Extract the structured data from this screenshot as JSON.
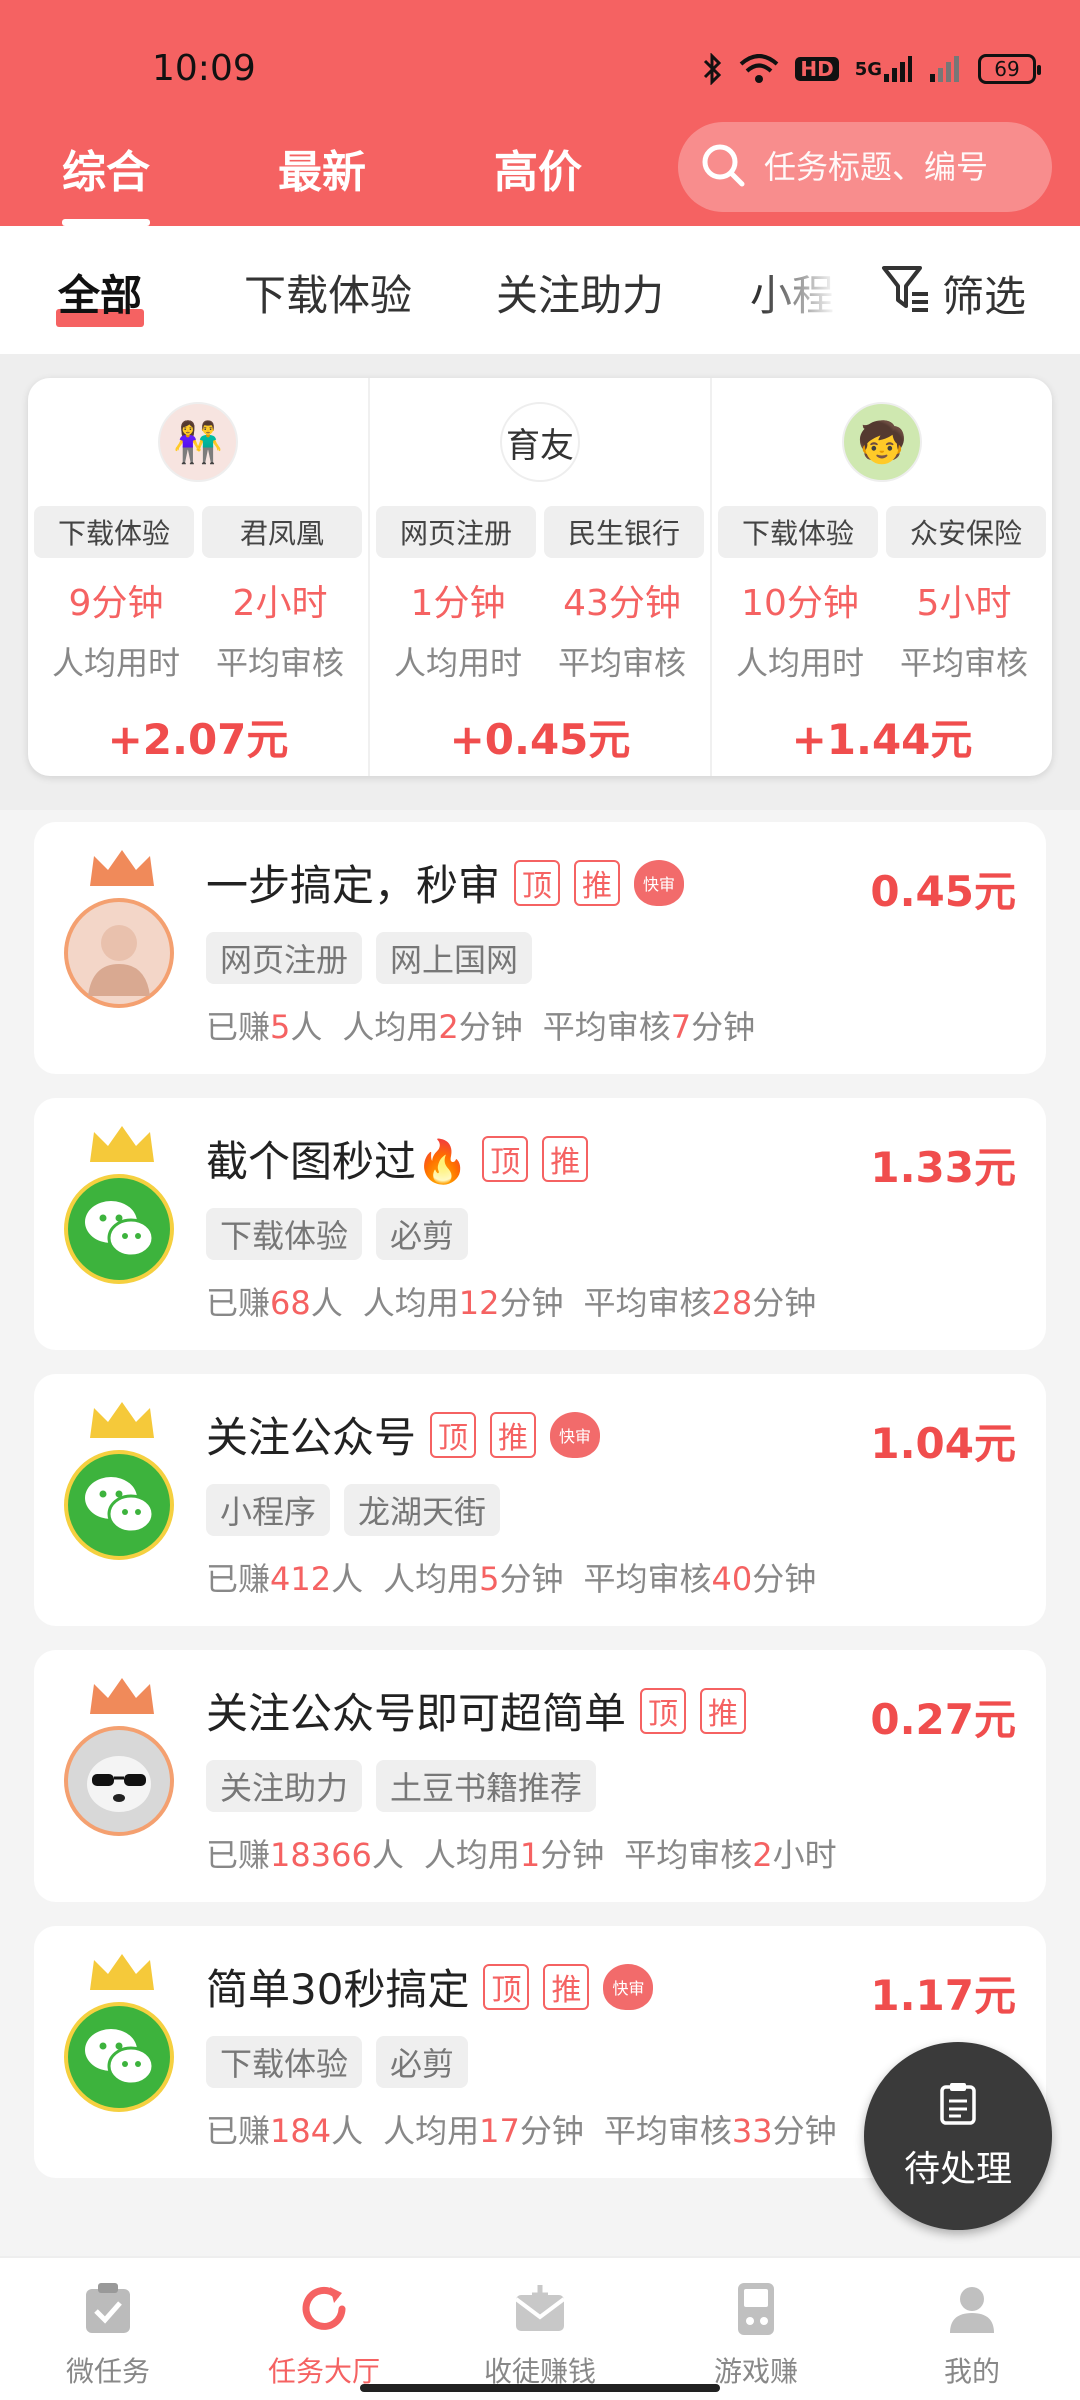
{
  "status_bar": {
    "time": "10:09",
    "hd_label": "HD",
    "signal_label": "5G",
    "battery": "69"
  },
  "top_tabs": [
    "综合",
    "最新",
    "高价"
  ],
  "search": {
    "placeholder": "任务标题、编号"
  },
  "categories": [
    "全部",
    "下载体验",
    "关注助力",
    "小程"
  ],
  "filter_label": "筛选",
  "featured": [
    {
      "tag1": "下载体验",
      "tag2": "君凤凰",
      "time_value": "9分钟",
      "time_label": "人均用时",
      "review_value": "2小时",
      "review_label": "平均审核",
      "price": "+2.07元",
      "avatar": "couple-avatar-icon"
    },
    {
      "tag1": "网页注册",
      "tag2": "民生银行",
      "time_value": "1分钟",
      "time_label": "人均用时",
      "review_value": "43分钟",
      "review_label": "平均审核",
      "price": "+0.45元",
      "avatar": "calligraphy-avatar-icon"
    },
    {
      "tag1": "下载体验",
      "tag2": "众安保险",
      "time_value": "10分钟",
      "time_label": "人均用时",
      "review_value": "5小时",
      "review_label": "平均审核",
      "price": "+1.44元",
      "avatar": "cartoon-avatar-icon"
    }
  ],
  "badges": {
    "top": "顶",
    "recommend": "推",
    "fast": "快审"
  },
  "meta_labels": {
    "earned_prefix": "已赚",
    "earned_suffix": "人",
    "avg_time_prefix": "人均用",
    "avg_review_prefix": "平均审核"
  },
  "tasks": [
    {
      "title": "一步搞定，秒审",
      "price": "0.45元",
      "tags": [
        "网页注册",
        "网上国网"
      ],
      "earned": "5",
      "time": "2",
      "time_unit": "分钟",
      "review": "7",
      "review_unit": "分钟",
      "fast": true,
      "avatar": "photo-avatar-icon"
    },
    {
      "title": "截个图秒过🔥",
      "price": "1.33元",
      "tags": [
        "下载体验",
        "必剪"
      ],
      "earned": "68",
      "time": "12",
      "time_unit": "分钟",
      "review": "28",
      "review_unit": "分钟",
      "fast": false,
      "avatar": "wechat-avatar-icon"
    },
    {
      "title": "关注公众号",
      "price": "1.04元",
      "tags": [
        "小程序",
        "龙湖天街"
      ],
      "earned": "412",
      "time": "5",
      "time_unit": "分钟",
      "review": "40",
      "review_unit": "分钟",
      "fast": true,
      "avatar": "wechat-avatar-icon"
    },
    {
      "title": "关注公众号即可超简单",
      "price": "0.27元",
      "tags": [
        "关注助力",
        "土豆书籍推荐"
      ],
      "earned": "18366",
      "time": "1",
      "time_unit": "分钟",
      "review": "2",
      "review_unit": "小时",
      "fast": false,
      "avatar": "panda-avatar-icon"
    },
    {
      "title": "简单30秒搞定",
      "price": "1.17元",
      "tags": [
        "下载体验",
        "必剪"
      ],
      "earned": "184",
      "time": "17",
      "time_unit": "分钟",
      "review": "33",
      "review_unit": "分钟",
      "fast": true,
      "avatar": "wechat-avatar-icon"
    }
  ],
  "pending_label": "待处理",
  "bottom_nav": [
    "微任务",
    "任务大厅",
    "收徒赚钱",
    "游戏赚",
    "我的"
  ],
  "colors": {
    "brand": "#f56262",
    "price": "#f04d4d"
  }
}
